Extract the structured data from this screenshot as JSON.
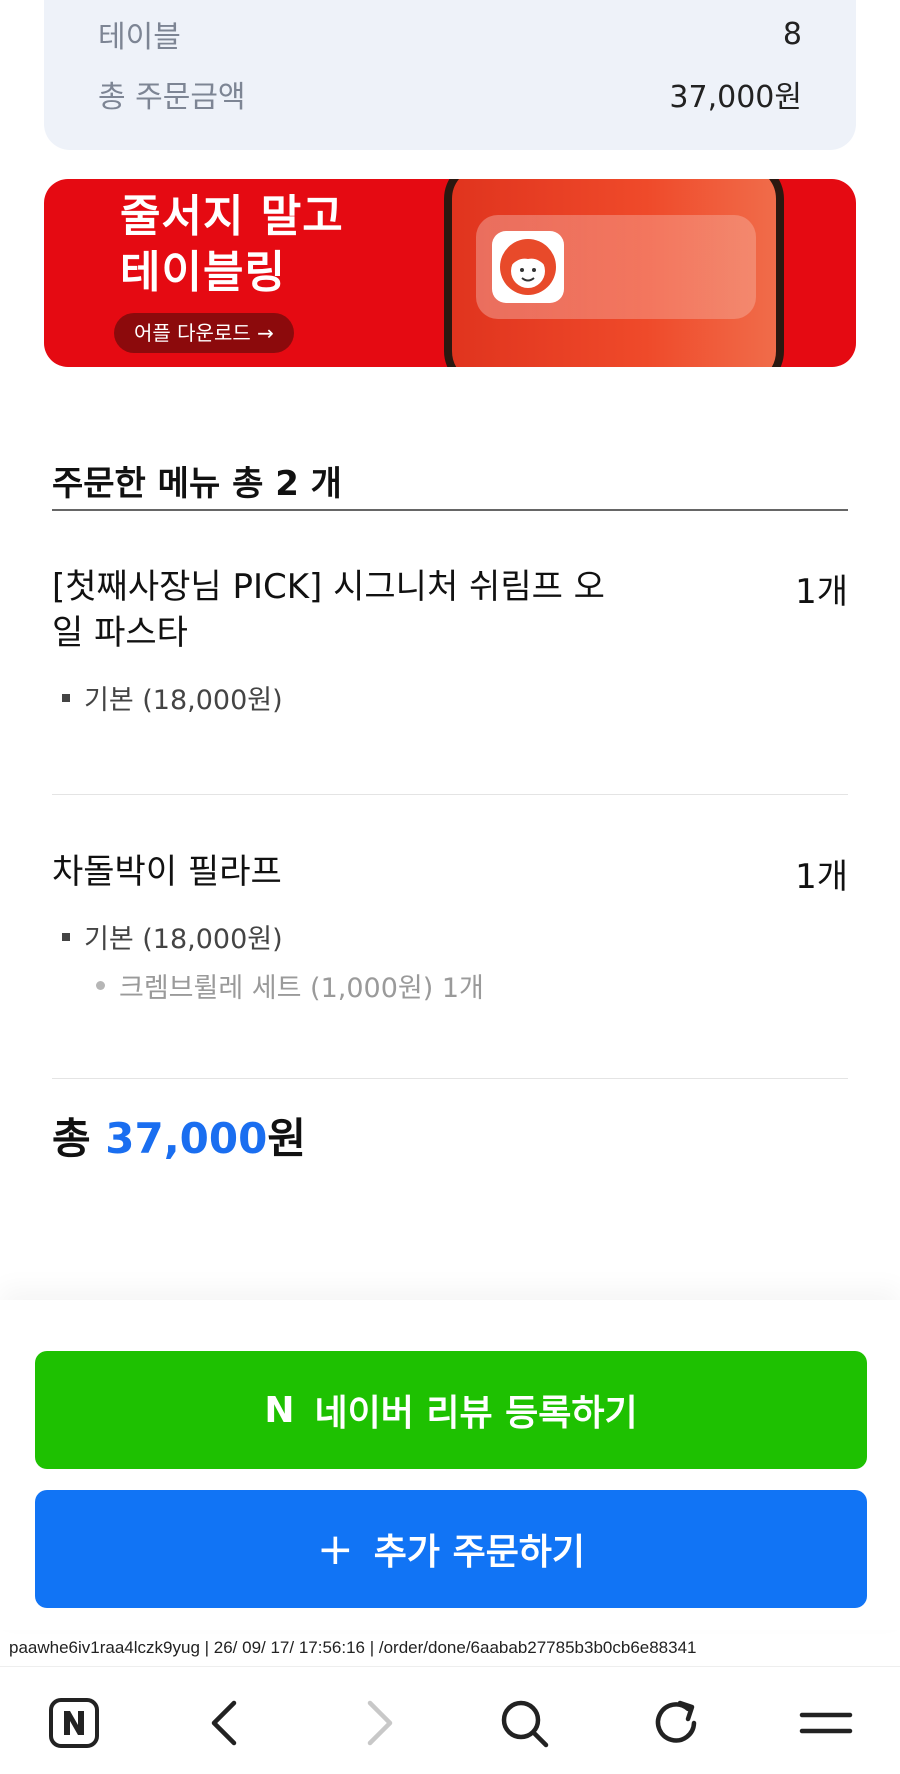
{
  "summary": {
    "rows": [
      {
        "label": "테이블",
        "value": "8"
      },
      {
        "label": "총 주문금액",
        "value": "37,000원"
      }
    ]
  },
  "banner": {
    "title_line1": "줄서지 말고",
    "title_line2": "테이블링",
    "button_label": "어플 다운로드 →",
    "color": "#e50a12"
  },
  "order": {
    "section_title": "주문한 메뉴 총 2 개",
    "items": [
      {
        "name": "[첫째사장님 PICK] 시그니처 쉬림프 오일 파스타",
        "qty": "1개",
        "option": "기본 (18,000원)",
        "sub_options": []
      },
      {
        "name": "차돌박이 필라프",
        "qty": "1개",
        "option": "기본 (18,000원)",
        "sub_options": [
          "크렘브륄레 세트 (1,000원) 1개"
        ]
      }
    ],
    "total_prefix": "총 ",
    "total_amount": "37,000",
    "total_suffix": "원",
    "accent_color": "#1a6ef0"
  },
  "actions": {
    "naver_logo": "N",
    "naver_review_label": "네이버 리뷰 등록하기",
    "naver_color": "#1ec101",
    "add_order_icon": "+",
    "add_order_label": "추가 주문하기",
    "add_order_color": "#1174f5"
  },
  "status_line": "paawhe6iv1raa4lczk9yug | 26/ 09/ 17/ 17:56:16 | /order/done/6aabab27785b3b0cb6e88341",
  "navbar": {
    "icons": [
      "naver-home-icon",
      "back-icon",
      "forward-icon",
      "search-icon",
      "reload-icon",
      "menu-icon"
    ]
  }
}
